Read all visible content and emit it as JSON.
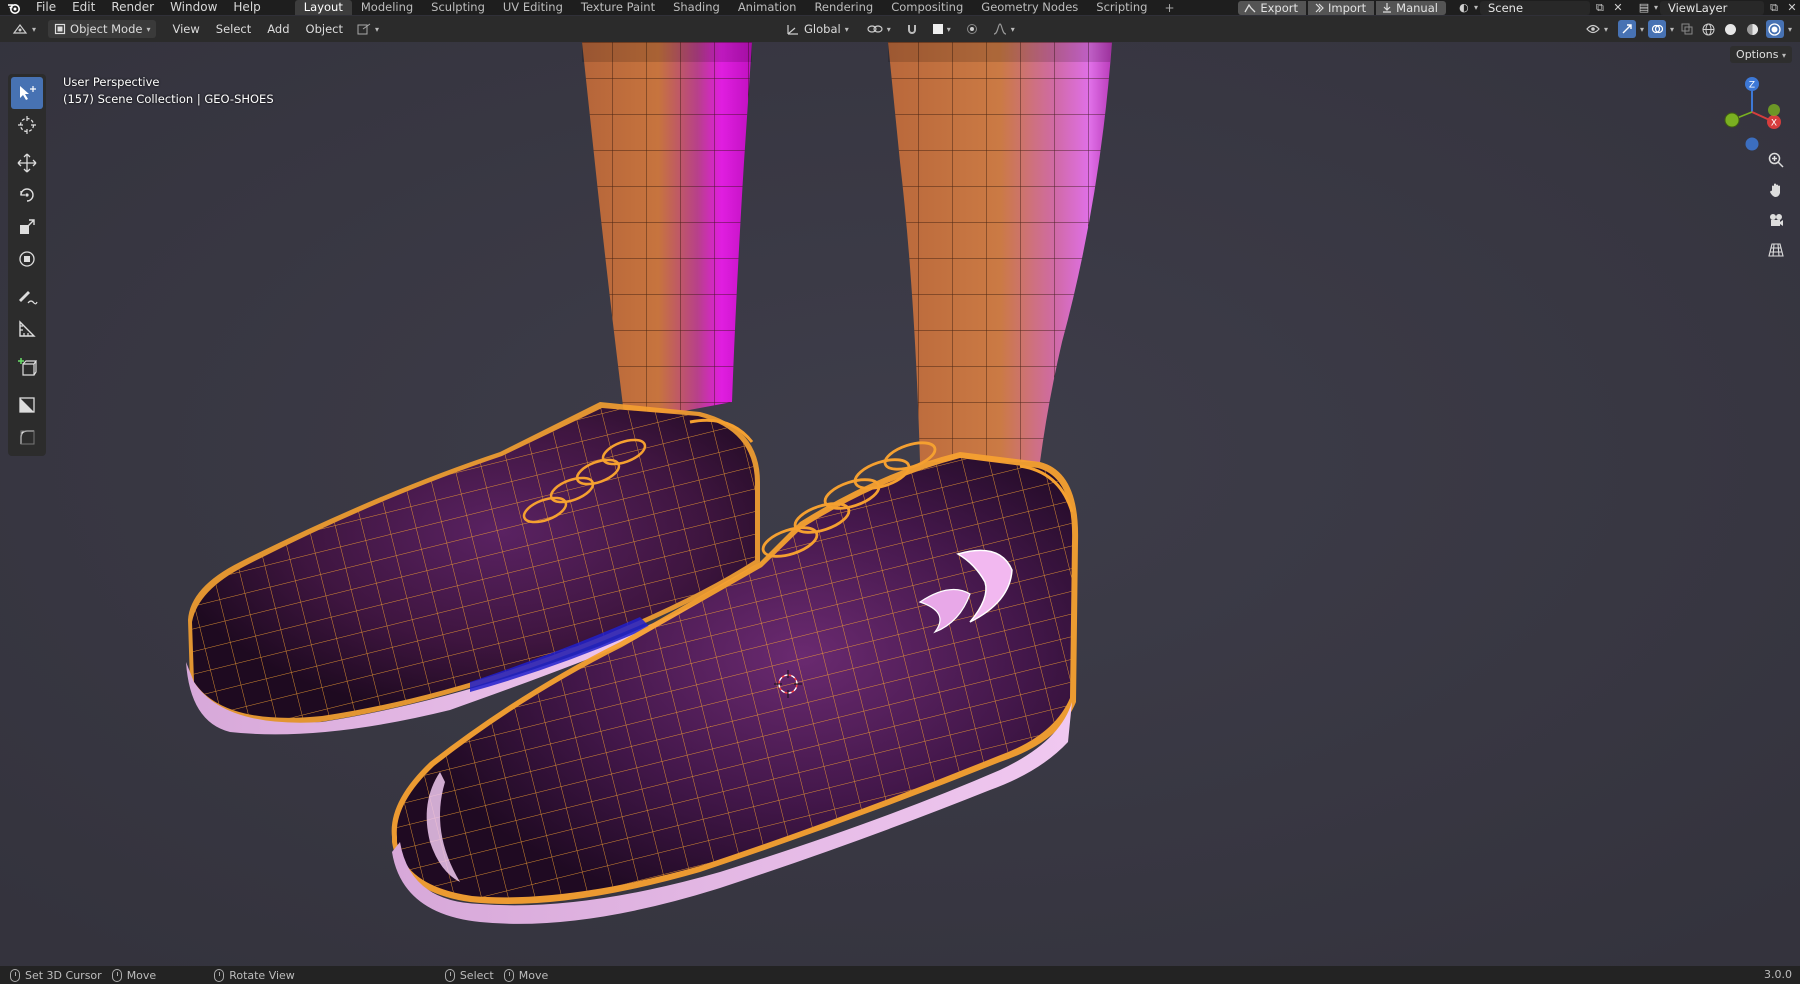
{
  "menubar": {
    "items": [
      "File",
      "Edit",
      "Render",
      "Window",
      "Help"
    ]
  },
  "workspaces": {
    "tabs": [
      "Layout",
      "Modeling",
      "Sculpting",
      "UV Editing",
      "Texture Paint",
      "Shading",
      "Animation",
      "Rendering",
      "Compositing",
      "Geometry Nodes",
      "Scripting"
    ],
    "active": "Layout",
    "add_label": "+"
  },
  "topbar_right": {
    "export_label": "Export",
    "import_label": "Import",
    "manual_label": "Manual",
    "scene_name": "Scene",
    "view_layer_name": "ViewLayer"
  },
  "header": {
    "mode": "Object Mode",
    "menus": [
      "View",
      "Select",
      "Add",
      "Object"
    ],
    "orientation": "Global",
    "options_label": "Options"
  },
  "viewport": {
    "perspective_label": "User Perspective",
    "collection_label": "(157) Scene Collection | GEO-SHOES",
    "gizmo_axes": [
      "Z",
      "X",
      "Y"
    ]
  },
  "toolbar": {
    "tools": [
      "select-box-icon",
      "cursor-icon",
      "move-icon",
      "rotate-icon",
      "scale-icon",
      "transform-icon",
      "annotate-icon",
      "measure-icon",
      "add-cube-icon",
      "shade-icon",
      "bevel-icon"
    ],
    "active": "select-box-icon"
  },
  "statusbar": {
    "hints": [
      "Set 3D Cursor",
      "Move",
      "Rotate View",
      "Select",
      "Move"
    ],
    "version": "3.0.0"
  },
  "colors": {
    "accent": "#4772b3",
    "wire_selected": "#f5a030",
    "shoe_body": "#3c1540",
    "leg": "#c7743e",
    "leg_rim": "#e020e0",
    "viewport_bg": "#3a3a45"
  }
}
